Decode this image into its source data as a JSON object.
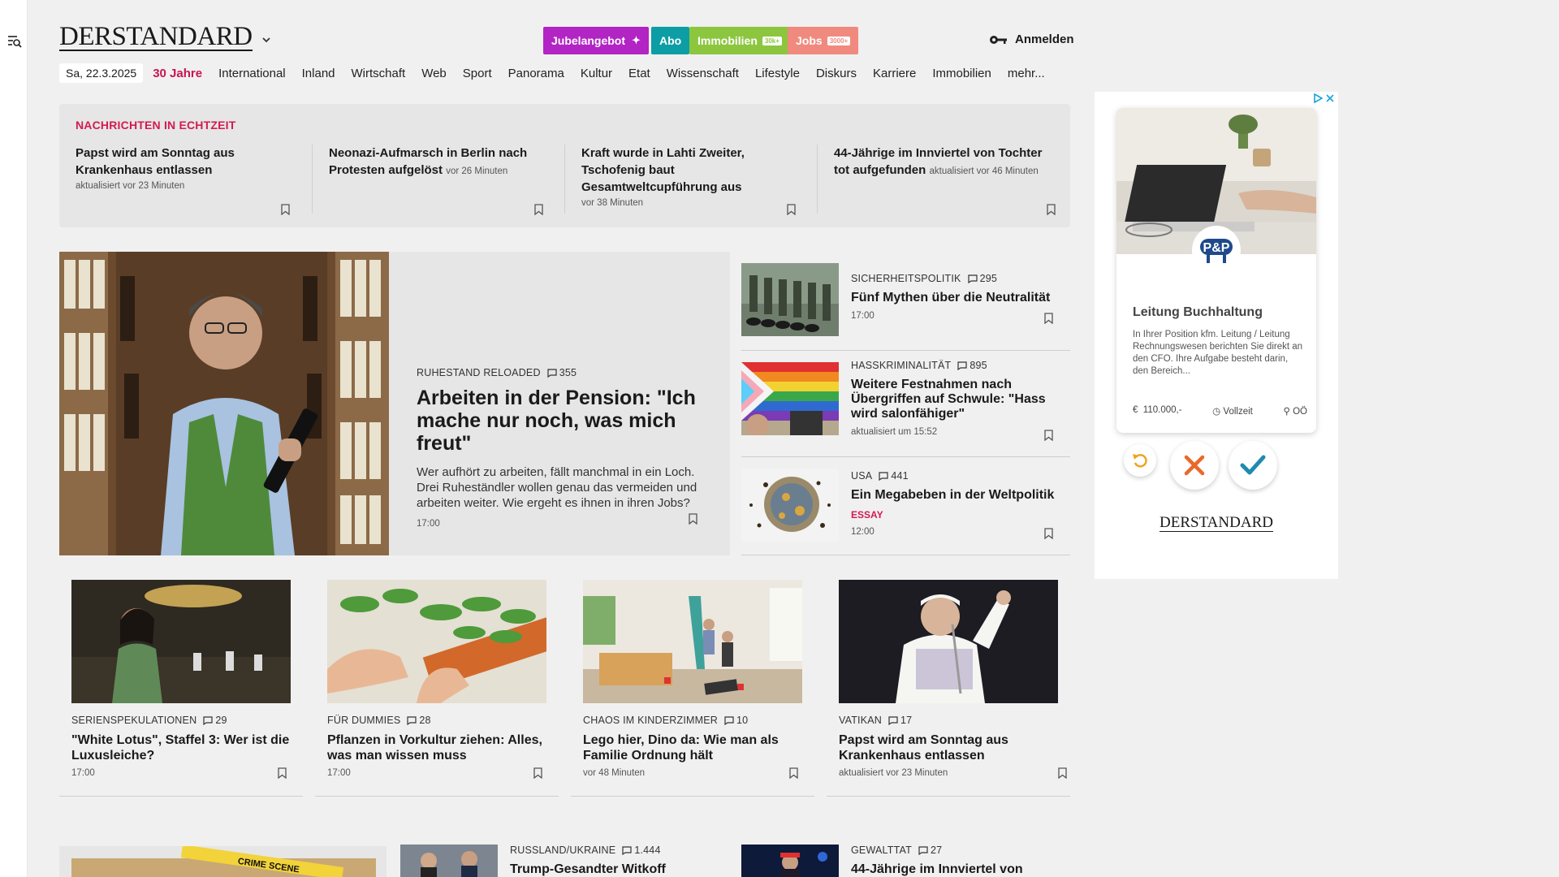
{
  "header": {
    "logo": "DERSTANDARD",
    "pills": [
      {
        "label": "Jubelangebot",
        "color": "#b224c4"
      },
      {
        "label": "Abo",
        "color": "#0c9ea4"
      },
      {
        "label": "Immobilien",
        "badge": "30k+",
        "color": "#8cc63e"
      },
      {
        "label": "Jobs",
        "badge": "3000+",
        "color": "#f08a7e"
      }
    ],
    "login": "Anmelden"
  },
  "nav": {
    "date": "Sa, 22.3.2025",
    "items": [
      "30 Jahre",
      "International",
      "Inland",
      "Wirtschaft",
      "Web",
      "Sport",
      "Panorama",
      "Kultur",
      "Etat",
      "Wissenschaft",
      "Lifestyle",
      "Diskurs",
      "Karriere",
      "Immobilien",
      "mehr..."
    ]
  },
  "ticker": {
    "title": "NACHRICHTEN IN ECHTZEIT",
    "items": [
      {
        "title": "Papst wird am Sonntag aus Krankenhaus entlassen",
        "meta": "aktualisiert vor 23 Minuten"
      },
      {
        "title": "Neonazi-Aufmarsch in Berlin nach Protesten aufgelöst",
        "meta": "vor 26 Minuten"
      },
      {
        "title": "Kraft wurde in Lahti Zweiter, Tschofenig baut Gesamtweltcupführung aus",
        "meta": "vor 38 Minuten"
      },
      {
        "title": "44-Jährige im Innviertel von Tochter tot aufgefunden",
        "meta": "aktualisiert vor 46 Minuten"
      }
    ]
  },
  "lead": {
    "kicker": "RUHESTAND RELOADED",
    "comments": "355",
    "title": "Arbeiten in der Pension: \"Ich mache nur noch, was mich freut\"",
    "teaser": "Wer aufhört zu arbeiten, fällt manchmal in ein Loch. Drei Ruheständler wollen genau das vermeiden und arbeiten weiter. Wie ergeht es ihnen in ihren Jobs?",
    "time": "17:00"
  },
  "side": [
    {
      "kicker": "SICHERHEITSPOLITIK",
      "comments": "295",
      "title": "Fünf Mythen über die Neutralität",
      "meta": "17:00"
    },
    {
      "kicker": "HASSKRIMINALITÄT",
      "comments": "895",
      "title": "Weitere Festnahmen nach Übergriffen auf Schwule: \"Hass wird salonfähiger\"",
      "meta": "aktualisiert um 15:52"
    },
    {
      "kicker": "USA",
      "comments": "441",
      "title": "Ein Megabeben in der Weltpolitik",
      "tag": "ESSAY",
      "meta": "12:00"
    }
  ],
  "cards": [
    {
      "kicker": "SERIENSPEKULATIONEN",
      "comments": "29",
      "title": "\"White Lotus\", Staffel 3: Wer ist die Luxusleiche?",
      "meta": "17:00"
    },
    {
      "kicker": "FÜR DUMMIES",
      "comments": "28",
      "title": "Pflanzen in Vorkultur ziehen: Alles, was man wissen muss",
      "meta": "17:00"
    },
    {
      "kicker": "CHAOS IM KINDERZIMMER",
      "comments": "10",
      "title": "Lego hier, Dino da: Wie man als Familie Ordnung hält",
      "meta": "vor 48 Minuten"
    },
    {
      "kicker": "VATIKAN",
      "comments": "17",
      "title": "Papst wird am Sonntag aus Krankenhaus entlassen",
      "meta": "aktualisiert vor 23 Minuten"
    }
  ],
  "bottom": [
    {
      "kicker": "RUSSLAND/UKRAINE",
      "comments": "1.444",
      "title": "Trump-Gesandter Witkoff"
    },
    {
      "kicker": "GEWALTTAT",
      "comments": "27",
      "title": "44-Jährige im Innviertel von"
    }
  ],
  "bottom_image_text": "CRIME SCENE",
  "ad": {
    "title": "Leitung Buchhaltung",
    "description": "In Ihrer Position kfm. Leitung / Leitung Rechnungswesen berichten Sie direkt an den CFO. Ihre Aufgabe besteht darin, den Bereich...",
    "salary": "110.000,-",
    "type": "Vollzeit",
    "location": "OÖ",
    "logo": "DERSTANDARD"
  },
  "colors": {
    "accent": "#d31b4f",
    "background": "#f0f0f0"
  }
}
